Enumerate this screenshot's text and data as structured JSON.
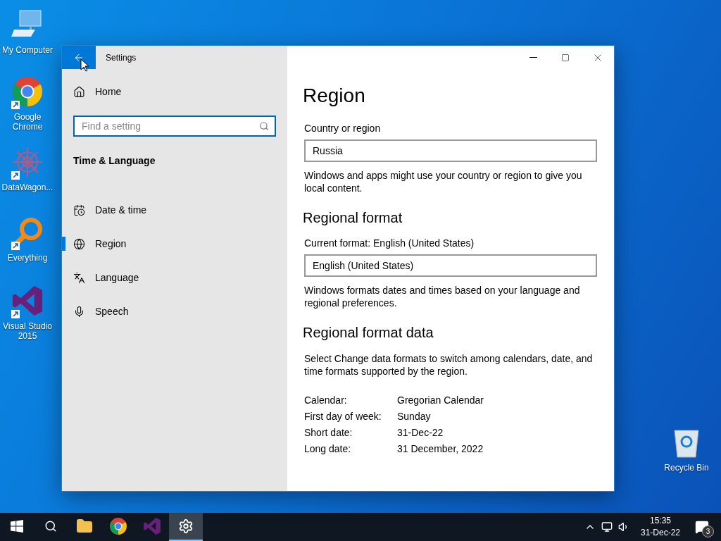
{
  "desktop_icons": [
    {
      "label": "My Computer",
      "kind": "computer",
      "shortcut": false
    },
    {
      "label": "Google Chrome",
      "kind": "chrome",
      "shortcut": true
    },
    {
      "label": "DataWagon...",
      "kind": "datawagon",
      "shortcut": true
    },
    {
      "label": "Everything",
      "kind": "everything",
      "shortcut": true
    },
    {
      "label": "Visual Studio 2015",
      "kind": "vs",
      "shortcut": true
    },
    {
      "label": "Recycle Bin",
      "kind": "recycle",
      "shortcut": false
    }
  ],
  "window": {
    "title": "Settings",
    "sidebar": {
      "home": "Home",
      "search": {
        "placeholder": "Find a setting"
      },
      "section": "Time & Language",
      "items": [
        {
          "label": "Date & time",
          "kind": "calendar",
          "selected": false
        },
        {
          "label": "Region",
          "kind": "globe",
          "selected": true
        },
        {
          "label": "Language",
          "kind": "language",
          "selected": false
        },
        {
          "label": "Speech",
          "kind": "mic",
          "selected": false
        }
      ]
    },
    "content": {
      "title": "Region",
      "sections": [
        {
          "kind": "dropdown",
          "label": "Country or region",
          "value": "Russia",
          "note": "Windows and apps might use your country or region to give you local content."
        },
        {
          "kind": "dropdown",
          "heading": "Regional format",
          "label": "Current format: English (United States)",
          "value": "English (United States)",
          "note": "Windows formats dates and times based on your language and regional preferences."
        },
        {
          "kind": "table",
          "heading": "Regional format data",
          "note": "Select Change data formats to switch among calendars, date, and time formats supported by the region.",
          "rows": [
            {
              "key": "Calendar:",
              "value": "Gregorian Calendar"
            },
            {
              "key": "First day of week:",
              "value": "Sunday"
            },
            {
              "key": "Short date:",
              "value": "31-Dec-22"
            },
            {
              "key": "Long date:",
              "value": "31 December, 2022"
            }
          ]
        }
      ]
    }
  },
  "taskbar": {
    "apps": [
      {
        "kind": "start",
        "selected": false
      },
      {
        "kind": "search",
        "selected": false
      },
      {
        "kind": "explorer",
        "selected": false
      },
      {
        "kind": "chrome",
        "selected": false
      },
      {
        "kind": "vs",
        "selected": false
      },
      {
        "kind": "settings",
        "selected": true
      }
    ],
    "time": "15:35",
    "date": "31-Dec-22",
    "notifications": "3"
  }
}
